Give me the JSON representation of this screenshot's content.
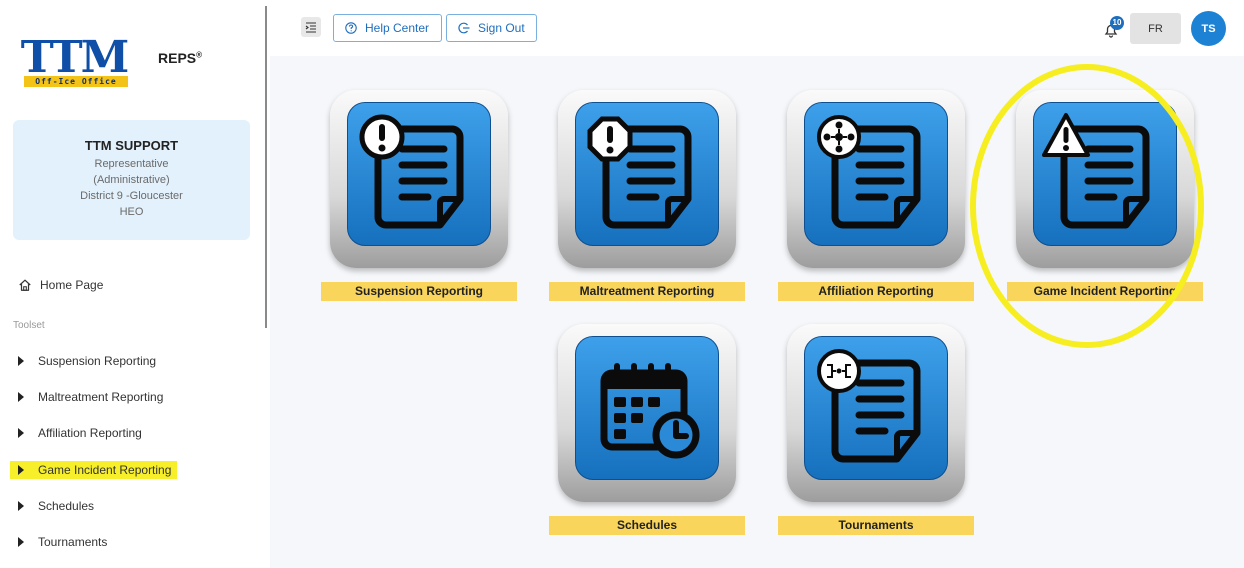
{
  "brand": {
    "logo_text": "TTM",
    "logo_tagline": "Off-Ice Office",
    "product": "REPS",
    "product_mark": "®"
  },
  "profile": {
    "name": "TTM SUPPORT",
    "lines": [
      "Representative",
      "(Administrative)",
      "District 9 -Gloucester",
      "HEO"
    ]
  },
  "nav": {
    "home": "Home Page",
    "section": "Toolset",
    "items": [
      {
        "label": "Suspension Reporting"
      },
      {
        "label": "Maltreatment Reporting"
      },
      {
        "label": "Affiliation Reporting"
      },
      {
        "label": "Game Incident Reporting",
        "highlighted": true
      },
      {
        "label": "Schedules"
      },
      {
        "label": "Tournaments"
      }
    ]
  },
  "topbar": {
    "help_label": "Help Center",
    "signout_label": "Sign Out",
    "notifications": "10",
    "language": "FR",
    "user_initials": "TS"
  },
  "tiles": [
    {
      "label": "Suspension Reporting",
      "icon": "document-exclamation-circle-icon"
    },
    {
      "label": "Maltreatment Reporting",
      "icon": "document-exclamation-octagon-icon"
    },
    {
      "label": "Affiliation Reporting",
      "icon": "document-network-icon"
    },
    {
      "label": "Game Incident Reporting",
      "icon": "document-warning-triangle-icon",
      "highlighted": true
    },
    {
      "label": "Schedules",
      "icon": "calendar-clock-icon"
    },
    {
      "label": "Tournaments",
      "icon": "document-bracket-icon"
    }
  ],
  "colors": {
    "accent": "#1f6ebd",
    "label_bg": "#fad55c",
    "highlight": "#f6ee20",
    "profile_bg": "#e3f1fc"
  }
}
